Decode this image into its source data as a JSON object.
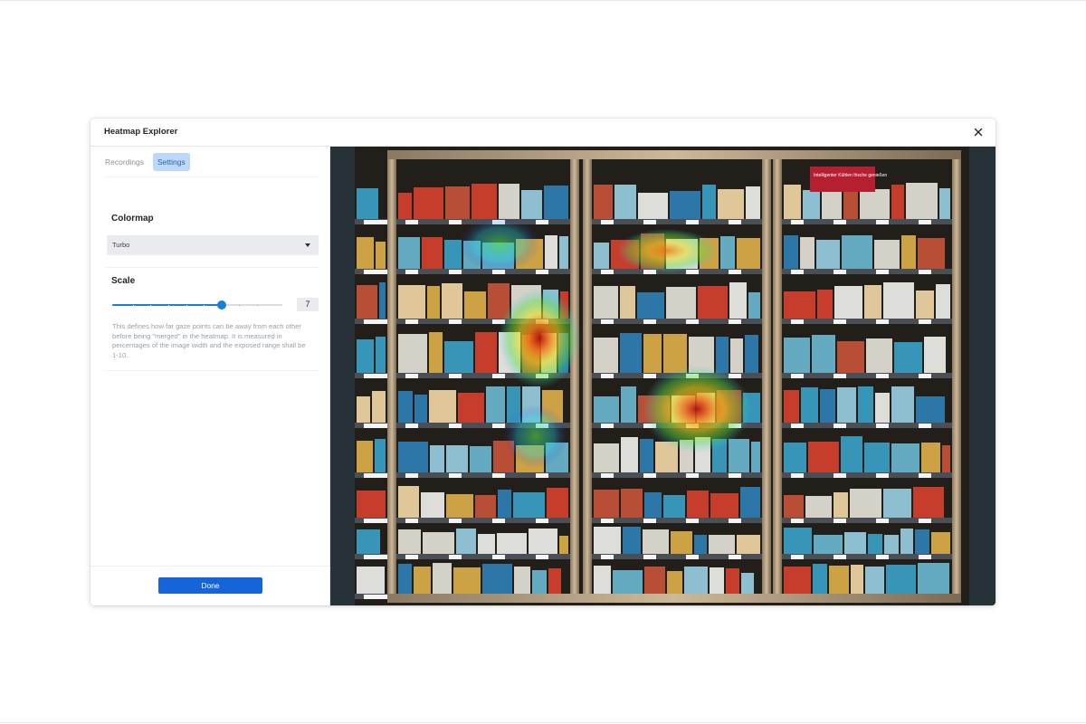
{
  "dialog": {
    "title": "Heatmap Explorer",
    "close_icon": "close-icon"
  },
  "tabs": [
    {
      "label": "Recordings",
      "active": false
    },
    {
      "label": "Settings",
      "active": true
    }
  ],
  "colormap": {
    "label": "Colormap",
    "selected": "Turbo"
  },
  "scale": {
    "label": "Scale",
    "value": "7",
    "min": 1,
    "max": 10,
    "help": "This defines how far gaze points can be away from each other before being \"merged\" in the heatmap. It is measured in percentages of the image width and the exposed range shall be 1-10."
  },
  "footer": {
    "done_label": "Done"
  },
  "image": {
    "subject": "supermarket freezer shelves with gaze heatmap overlay",
    "shelf_sign_text": "Intelligenter Kühlen frische genießen",
    "colormap_colors": [
      "#1e2de0",
      "#1fd0e8",
      "#5be040",
      "#e8e020",
      "#f07818",
      "#b01010"
    ]
  },
  "colors": {
    "accent": "#1565d8",
    "slider": "#1b7fd6",
    "tab_active_bg": "#bcd9fb",
    "image_bg": "#263238"
  }
}
